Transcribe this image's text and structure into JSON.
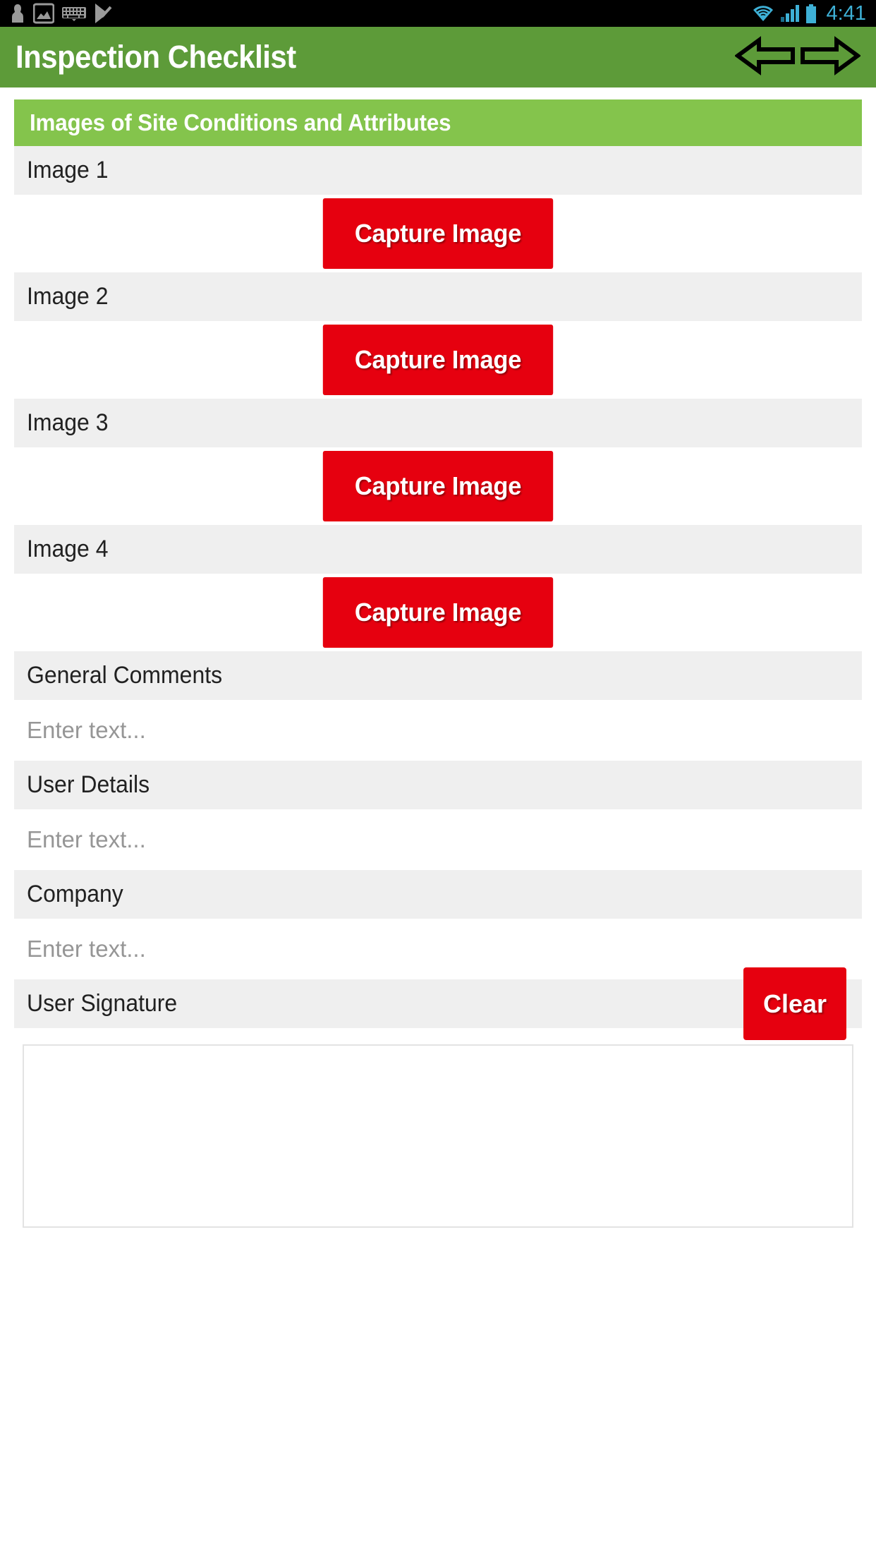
{
  "status_bar": {
    "icons_left": [
      "contact-icon",
      "image-icon",
      "keyboard-icon",
      "check-flag-icon"
    ],
    "icons_right": [
      "wifi-icon",
      "signal-icon",
      "battery-icon"
    ],
    "time": "4:41",
    "accent_color": "#3eb0d6",
    "background": "#000000"
  },
  "app_bar": {
    "title": "Inspection Checklist",
    "background": "#5d9b39",
    "nav_prev_icon": "arrow-left-icon",
    "nav_next_icon": "arrow-right-icon"
  },
  "section": {
    "title": "Images of Site Conditions and Attributes",
    "background": "#84c44c"
  },
  "colors": {
    "button_red": "#e6000f",
    "row_gray": "#efefef",
    "placeholder_gray": "#969696",
    "label_black": "#212121",
    "border_gray": "#e3e3e3"
  },
  "image_items": [
    {
      "label": "Image 1",
      "button_label": "Capture Image"
    },
    {
      "label": "Image 2",
      "button_label": "Capture Image"
    },
    {
      "label": "Image 3",
      "button_label": "Capture Image"
    },
    {
      "label": "Image 4",
      "button_label": "Capture Image"
    }
  ],
  "text_fields": [
    {
      "label": "General Comments",
      "value": "",
      "placeholder": "Enter text..."
    },
    {
      "label": "User Details",
      "value": "",
      "placeholder": "Enter text..."
    },
    {
      "label": "Company",
      "value": "",
      "placeholder": "Enter text..."
    }
  ],
  "signature": {
    "label": "User Signature",
    "clear_label": "Clear",
    "canvas_value": ""
  }
}
